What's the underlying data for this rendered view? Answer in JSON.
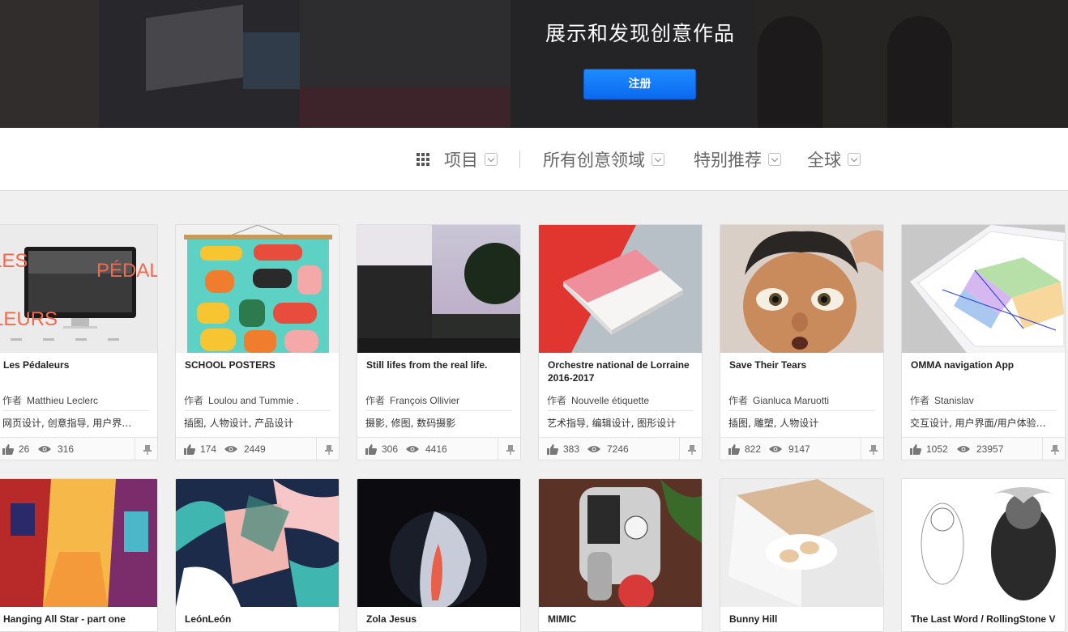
{
  "hero": {
    "title": "展示和发现创意作品",
    "signup_label": "注册"
  },
  "filters": {
    "projects": "项目",
    "fields": "所有创意领域",
    "featured": "特别推荐",
    "location": "全球"
  },
  "labels": {
    "by": "作者"
  },
  "icons": {
    "appreciate": "thumbs-up-icon",
    "views": "eye-icon",
    "save": "pin-icon",
    "grid": "grid-icon"
  },
  "projects": [
    {
      "title": "Les Pédaleurs",
      "author": "Matthieu Leclerc",
      "fields": "网页设计, 创意指导, 用户界…",
      "appreciations": "26",
      "views": "316"
    },
    {
      "title": "SCHOOL POSTERS",
      "author": "Loulou and Tummie .",
      "fields": "插图, 人物设计, 产品设计",
      "appreciations": "174",
      "views": "2449"
    },
    {
      "title": "Still lifes from the real life.",
      "author": "François Ollivier",
      "fields": "摄影, 修图, 数码摄影",
      "appreciations": "306",
      "views": "4416"
    },
    {
      "title": "Orchestre national de Lorraine 2016-2017",
      "author": "Nouvelle étiquette",
      "fields": "艺术指导, 编辑设计, 图形设计",
      "appreciations": "383",
      "views": "7246"
    },
    {
      "title": "Save Their Tears",
      "author": "Gianluca Maruotti",
      "fields": "插图, 雕塑, 人物设计",
      "appreciations": "822",
      "views": "9147"
    },
    {
      "title": "OMMA navigation App",
      "author": "Stanislav",
      "fields": "交互设计, 用户界面/用户体验…",
      "appreciations": "1052",
      "views": "23957"
    },
    {
      "title": "Hanging All Star - part one"
    },
    {
      "title": "LeónLeón"
    },
    {
      "title": "Zola Jesus"
    },
    {
      "title": "MIMIC"
    },
    {
      "title": "Bunny Hill"
    },
    {
      "title": "The Last Word / RollingStone V"
    }
  ],
  "thumb_texts": {
    "pedaleurs_left_top": "LES",
    "pedaleurs_right": "PÉDAL",
    "pedaleurs_left_bottom": "LEURS"
  }
}
